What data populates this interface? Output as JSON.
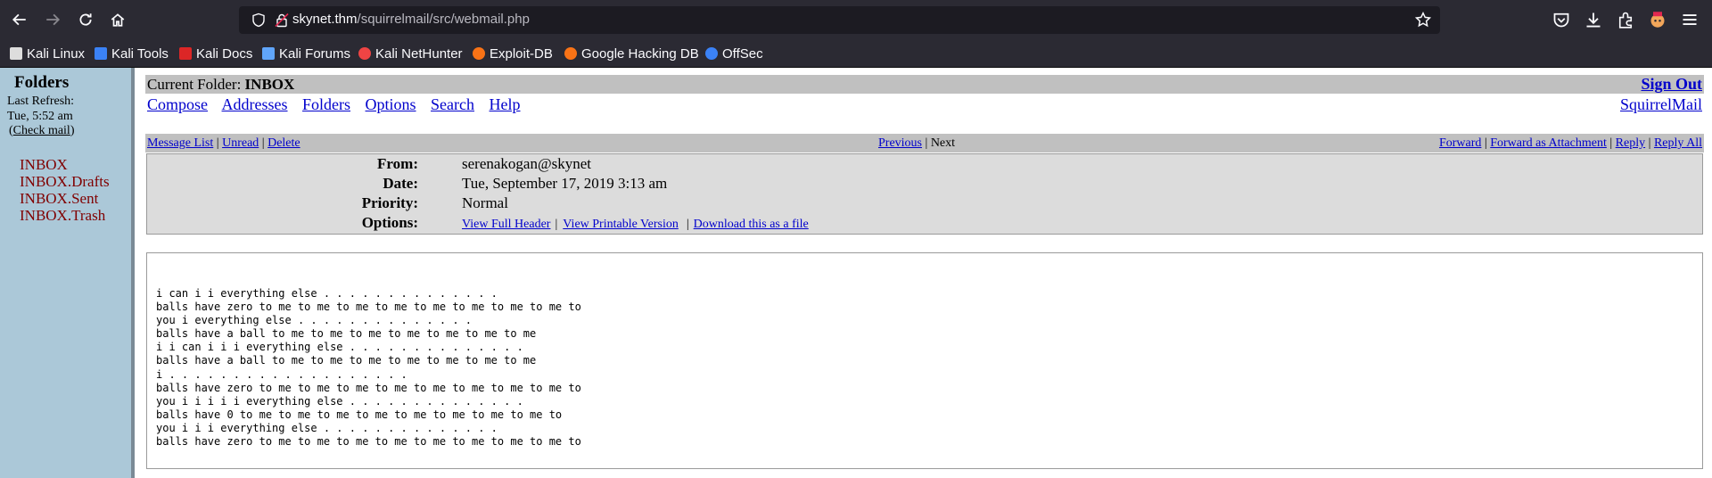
{
  "browser": {
    "url_host": "skynet.thm",
    "url_path": "/squirrelmail/src/webmail.php",
    "bookmarks": [
      "Kali Linux",
      "Kali Tools",
      "Kali Docs",
      "Kali Forums",
      "Kali NetHunter",
      "Exploit-DB",
      "Google Hacking DB",
      "OffSec"
    ],
    "icons": [
      "back-icon",
      "forward-icon",
      "reload-icon",
      "home-icon",
      "shield-icon",
      "lock-icon",
      "bookmark-star-icon",
      "pocket-icon",
      "downloads-icon",
      "extensions-icon",
      "profile-icon",
      "menu-icon"
    ]
  },
  "sidebar": {
    "title": "Folders",
    "last_refresh_label": "Last Refresh:",
    "last_refresh_time": "Tue, 5:52 am",
    "check_mail_open": "(",
    "check_mail": "Check mail",
    "check_mail_close": ")",
    "folders": [
      "INBOX",
      "INBOX.Drafts",
      "INBOX.Sent",
      "INBOX.Trash"
    ]
  },
  "top": {
    "current_folder_label": "Current Folder: ",
    "current_folder": "INBOX",
    "sign_out": "Sign Out",
    "menu": [
      "Compose",
      "Addresses",
      "Folders",
      "Options",
      "Search",
      "Help"
    ],
    "brand_link": "SquirrelMail"
  },
  "message_nav": {
    "left": [
      "Message List",
      "Unread",
      "Delete"
    ],
    "previous": "Previous",
    "next": "Next",
    "right": [
      "Forward",
      "Forward as Attachment",
      "Reply",
      "Reply All"
    ],
    "separator": "|"
  },
  "header": {
    "from_label": "From:",
    "from": "serenakogan@skynet",
    "date_label": "Date:",
    "date": "Tue, September 17, 2019 3:13 am",
    "priority_label": "Priority:",
    "priority": "Normal",
    "options_label": "Options:",
    "options": [
      "View Full Header",
      "View Printable Version",
      "Download this as a file"
    ]
  },
  "body": {
    "text": "i can i i everything else . . . . . . . . . . . . . .\nballs have zero to me to me to me to me to me to me to me to me to\nyou i everything else . . . . . . . . . . . . . .\nballs have a ball to me to me to me to me to me to me to me\ni i can i i i everything else . . . . . . . . . . . . . .\nballs have a ball to me to me to me to me to me to me to me\ni . . . . . . . . . . . . . . . . . . .\nballs have zero to me to me to me to me to me to me to me to me to\nyou i i i i i everything else . . . . . . . . . . . . . .\nballs have 0 to me to me to me to me to me to me to me to me to\nyou i i i everything else . . . . . . . . . . . . . .\nballs have zero to me to me to me to me to me to me to me to me to"
  }
}
